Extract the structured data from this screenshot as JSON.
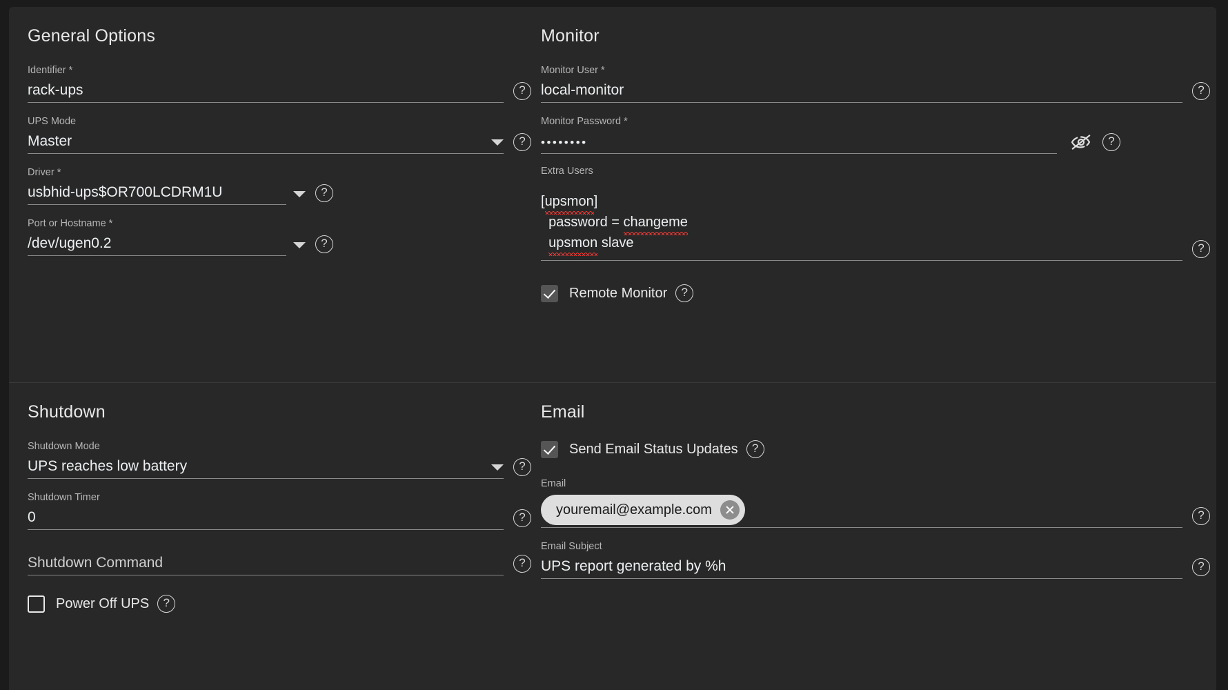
{
  "theme": {
    "page_bg": "#1b1b1b",
    "card_bg": "#282828",
    "text_primary": "#eceff1",
    "text_label": "#b6b6b6",
    "underline": "#8a8a8a",
    "checkbox_on": "#555555",
    "chip_bg": "#dedede",
    "spellcheck": "#e53935"
  },
  "general": {
    "title": "General Options",
    "identifier": {
      "label": "Identifier *",
      "value": "rack-ups",
      "help": "?"
    },
    "ups_mode": {
      "label": "UPS Mode",
      "value": "Master",
      "help": "?"
    },
    "driver": {
      "label": "Driver *",
      "value": "usbhid-ups$OR700LCDRM1U",
      "help": "?"
    },
    "port": {
      "label": "Port or Hostname *",
      "value": "/dev/ugen0.2",
      "help": "?"
    }
  },
  "monitor": {
    "title": "Monitor",
    "monitor_user": {
      "label": "Monitor User *",
      "value": "local-monitor",
      "help": "?"
    },
    "monitor_password": {
      "label": "Monitor Password *",
      "value": "••••••••",
      "help": "?"
    },
    "extra_users": {
      "label": "Extra Users",
      "line1_a": "[",
      "line1_b": "upsmon",
      "line1_c": "]",
      "line2_a": "  password = ",
      "line2_b": "changeme",
      "line3_a": "  ",
      "line3_b": "upsmon",
      "line3_c": " slave",
      "value": "[upsmon]\n  password = changeme\n  upsmon slave",
      "help": "?"
    },
    "remote_monitor": {
      "label": "Remote Monitor",
      "checked": true,
      "help": "?"
    }
  },
  "shutdown": {
    "title": "Shutdown",
    "shutdown_mode": {
      "label": "Shutdown Mode",
      "value": "UPS reaches low battery",
      "help": "?"
    },
    "shutdown_timer": {
      "label": "Shutdown Timer",
      "value": "0",
      "help": "?"
    },
    "shutdown_command": {
      "label": "",
      "placeholder": "Shutdown Command",
      "value": "",
      "help": "?"
    },
    "power_off_ups": {
      "label": "Power Off UPS",
      "checked": false,
      "help": "?"
    }
  },
  "email": {
    "title": "Email",
    "send_updates": {
      "label": "Send Email Status Updates",
      "checked": true,
      "help": "?"
    },
    "email": {
      "label": "Email",
      "chip": "youremail@example.com",
      "help": "?"
    },
    "email_subject": {
      "label": "Email Subject",
      "value": "UPS report generated by %h",
      "help": "?"
    }
  }
}
